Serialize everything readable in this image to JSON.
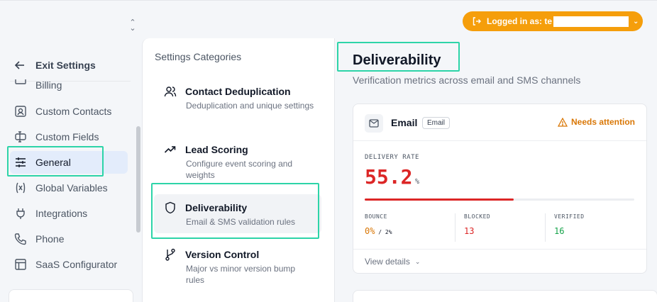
{
  "header": {
    "login_prefix": "Logged in as: te",
    "accent": "#f59e0b"
  },
  "sidebar": {
    "exit_label": "Exit Settings",
    "items": [
      {
        "label": "Billing",
        "icon": "billing-icon"
      },
      {
        "label": "Custom Contacts",
        "icon": "contact-card-icon"
      },
      {
        "label": "Custom Fields",
        "icon": "fields-icon"
      },
      {
        "label": "General",
        "icon": "sliders-icon",
        "active": true
      },
      {
        "label": "Global Variables",
        "icon": "variable-icon"
      },
      {
        "label": "Integrations",
        "icon": "plug-icon"
      },
      {
        "label": "Phone",
        "icon": "phone-icon"
      },
      {
        "label": "SaaS Configurator",
        "icon": "layout-icon"
      }
    ]
  },
  "categories": {
    "title": "Settings Categories",
    "items": [
      {
        "label": "Contact Deduplication",
        "desc": "Deduplication and unique settings",
        "icon": "users-icon"
      },
      {
        "label": "Lead Scoring",
        "desc": "Configure event scoring and weights",
        "icon": "trend-icon"
      },
      {
        "label": "Deliverability",
        "desc": "Email & SMS validation rules",
        "icon": "shield-icon",
        "active": true
      },
      {
        "label": "Version Control",
        "desc": "Major vs minor version bump rules",
        "icon": "branch-icon"
      }
    ]
  },
  "main": {
    "title": "Deliverability",
    "subtitle": "Verification metrics across email and SMS channels",
    "email_card": {
      "name": "Email",
      "badge": "Email",
      "status": "Needs attention",
      "rate_label": "DELIVERY RATE",
      "rate_value": "55.2",
      "rate_unit": "%",
      "rate_fraction": 0.552,
      "stats": [
        {
          "label": "BOUNCE",
          "value": "0%",
          "extra": " / 2%",
          "color": "#d97706"
        },
        {
          "label": "BLOCKED",
          "value": "13",
          "color": "#dc2626"
        },
        {
          "label": "VERIFIED",
          "value": "16",
          "color": "#16a34a"
        }
      ],
      "view_details": "View details"
    }
  }
}
